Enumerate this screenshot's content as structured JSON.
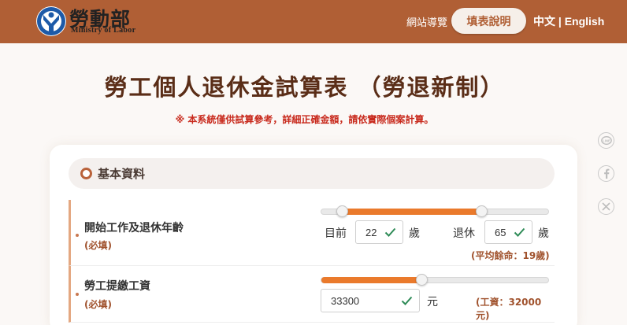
{
  "header": {
    "logo_cn": "勞動部",
    "logo_en": "Ministry  of  Labor",
    "sitemap_label": "網站導覽",
    "guide_label": "填表說明",
    "lang_zh": "中文",
    "lang_sep": " | ",
    "lang_en": "English"
  },
  "page": {
    "title": "勞工個人退休金試算表 （勞退新制）",
    "disclaimer": "※ 本系統僅供試算參考，詳細正確金額，請依實際個案計算。"
  },
  "social": [
    "line-icon",
    "facebook-icon",
    "x-icon"
  ],
  "section": {
    "title": "基本資料"
  },
  "rows": [
    {
      "label": "開始工作及退休年齡",
      "required": "(必填)",
      "current_label": "目前",
      "current_value": "22",
      "current_unit": "歲",
      "retire_label": "退休",
      "retire_value": "65",
      "retire_unit": "歲",
      "note": "(平均餘命：19歲)",
      "slider_low_fraction": 0.09,
      "slider_high_fraction": 0.705
    },
    {
      "label": "勞工提繳工資",
      "required": "(必填)",
      "value": "33300",
      "unit": "元",
      "note": "(工資：32000元)",
      "slider_fraction": 0.44
    }
  ],
  "colors": {
    "brand": "#b05f35",
    "accent_orange": "#ea7a2c",
    "title_brown": "#5a2d17",
    "warning_red": "#c8291c",
    "check_green": "#2e8b57"
  }
}
